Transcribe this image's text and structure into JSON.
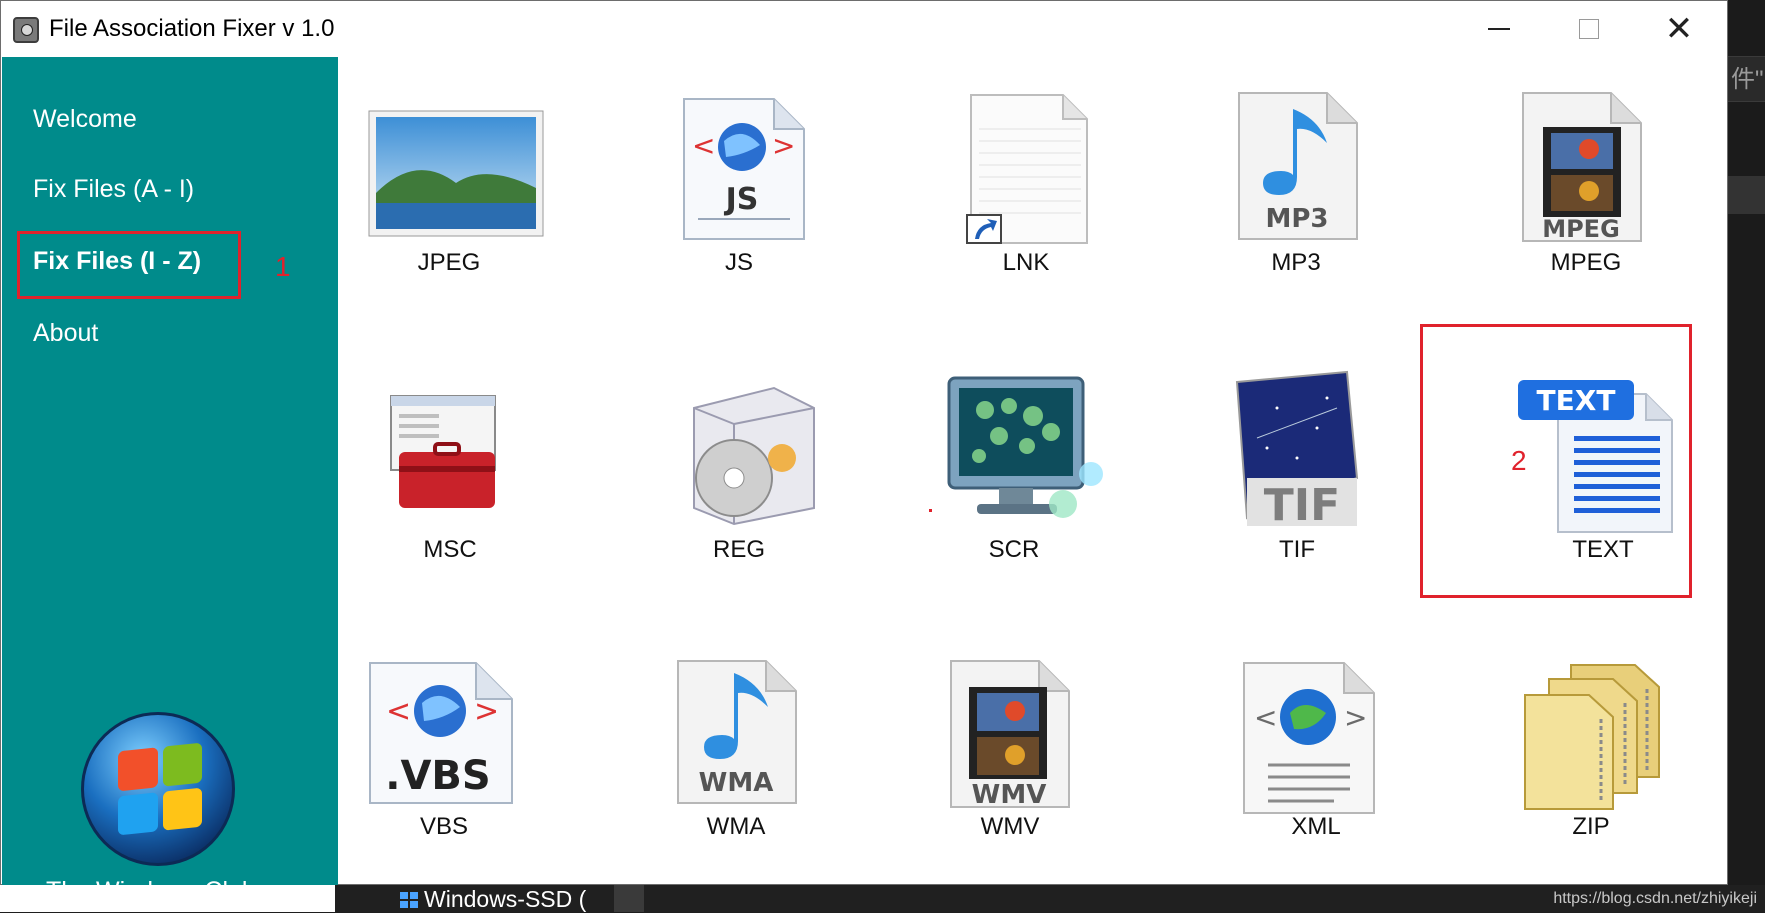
{
  "window": {
    "title": "File Association Fixer v 1.0",
    "controls": {
      "minimize": "minimize",
      "maximize": "maximize",
      "close": "✕"
    }
  },
  "sidebar": {
    "items": [
      {
        "label": "Welcome",
        "active": false
      },
      {
        "label": "Fix Files (A - I)",
        "active": false
      },
      {
        "label": "Fix Files (I - Z)",
        "active": true
      },
      {
        "label": "About",
        "active": false
      }
    ],
    "logo_caption": "The Windows Club"
  },
  "annotations": {
    "marker_1": "1",
    "marker_2": "2"
  },
  "file_types": [
    {
      "label": "JPEG",
      "icon": "jpeg-file-icon"
    },
    {
      "label": "JS",
      "icon": "js-file-icon",
      "badge": "JS"
    },
    {
      "label": "LNK",
      "icon": "lnk-file-icon"
    },
    {
      "label": "MP3",
      "icon": "mp3-file-icon",
      "badge": "MP3"
    },
    {
      "label": "MPEG",
      "icon": "mpeg-file-icon",
      "badge": "MPEG"
    },
    {
      "label": "MSC",
      "icon": "msc-file-icon"
    },
    {
      "label": "REG",
      "icon": "reg-file-icon"
    },
    {
      "label": "SCR",
      "icon": "scr-file-icon"
    },
    {
      "label": "TIF",
      "icon": "tif-file-icon",
      "badge": "TIF"
    },
    {
      "label": "TEXT",
      "icon": "text-file-icon",
      "badge": "TEXT"
    },
    {
      "label": "VBS",
      "icon": "vbs-file-icon",
      "badge": ".VBS"
    },
    {
      "label": "WMA",
      "icon": "wma-file-icon",
      "badge": "WMA"
    },
    {
      "label": "WMV",
      "icon": "wmv-file-icon",
      "badge": "WMV"
    },
    {
      "label": "XML",
      "icon": "xml-file-icon"
    },
    {
      "label": "ZIP",
      "icon": "zip-file-icon"
    }
  ],
  "background": {
    "taskbar_item": "Windows-SSD (",
    "right_edge_text": "件\"",
    "watermark": "https://blog.csdn.net/zhiyikeji"
  },
  "colors": {
    "sidebar_bg": "#008b8b",
    "highlight_red": "#e0222c"
  }
}
